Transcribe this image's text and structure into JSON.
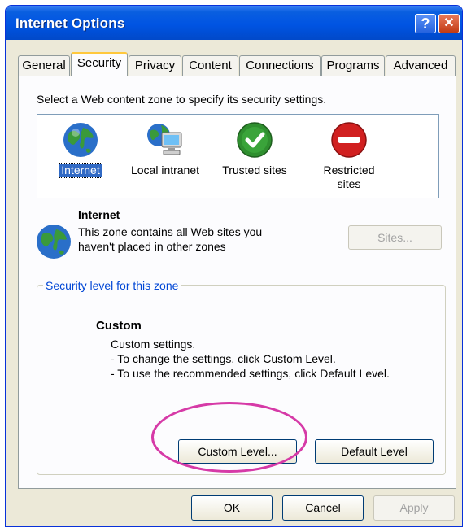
{
  "window": {
    "title": "Internet Options"
  },
  "tabs": [
    "General",
    "Security",
    "Privacy",
    "Content",
    "Connections",
    "Programs",
    "Advanced"
  ],
  "security": {
    "intro": "Select a Web content zone to specify its security settings.",
    "zones": [
      {
        "label": "Internet",
        "icon": "globe-icon"
      },
      {
        "label": "Local intranet",
        "icon": "intranet-icon"
      },
      {
        "label": "Trusted sites",
        "icon": "check-icon"
      },
      {
        "label": "Restricted sites",
        "icon": "no-entry-icon"
      }
    ],
    "selected_zone": {
      "name": "Internet",
      "description": "This zone contains all Web sites you haven't placed in other zones"
    },
    "sites_button": "Sites...",
    "level_group_title": "Security level for this zone",
    "level_title": "Custom",
    "level_lines": [
      "Custom settings.",
      "- To change the settings, click Custom Level.",
      "- To use the recommended settings, click Default Level."
    ],
    "custom_level_button": "Custom Level...",
    "default_level_button": "Default Level"
  },
  "footer": {
    "ok": "OK",
    "cancel": "Cancel",
    "apply": "Apply"
  },
  "colors": {
    "titlebar": "#0054e3",
    "highlight": "#d63aa7",
    "selection": "#316ac5"
  }
}
